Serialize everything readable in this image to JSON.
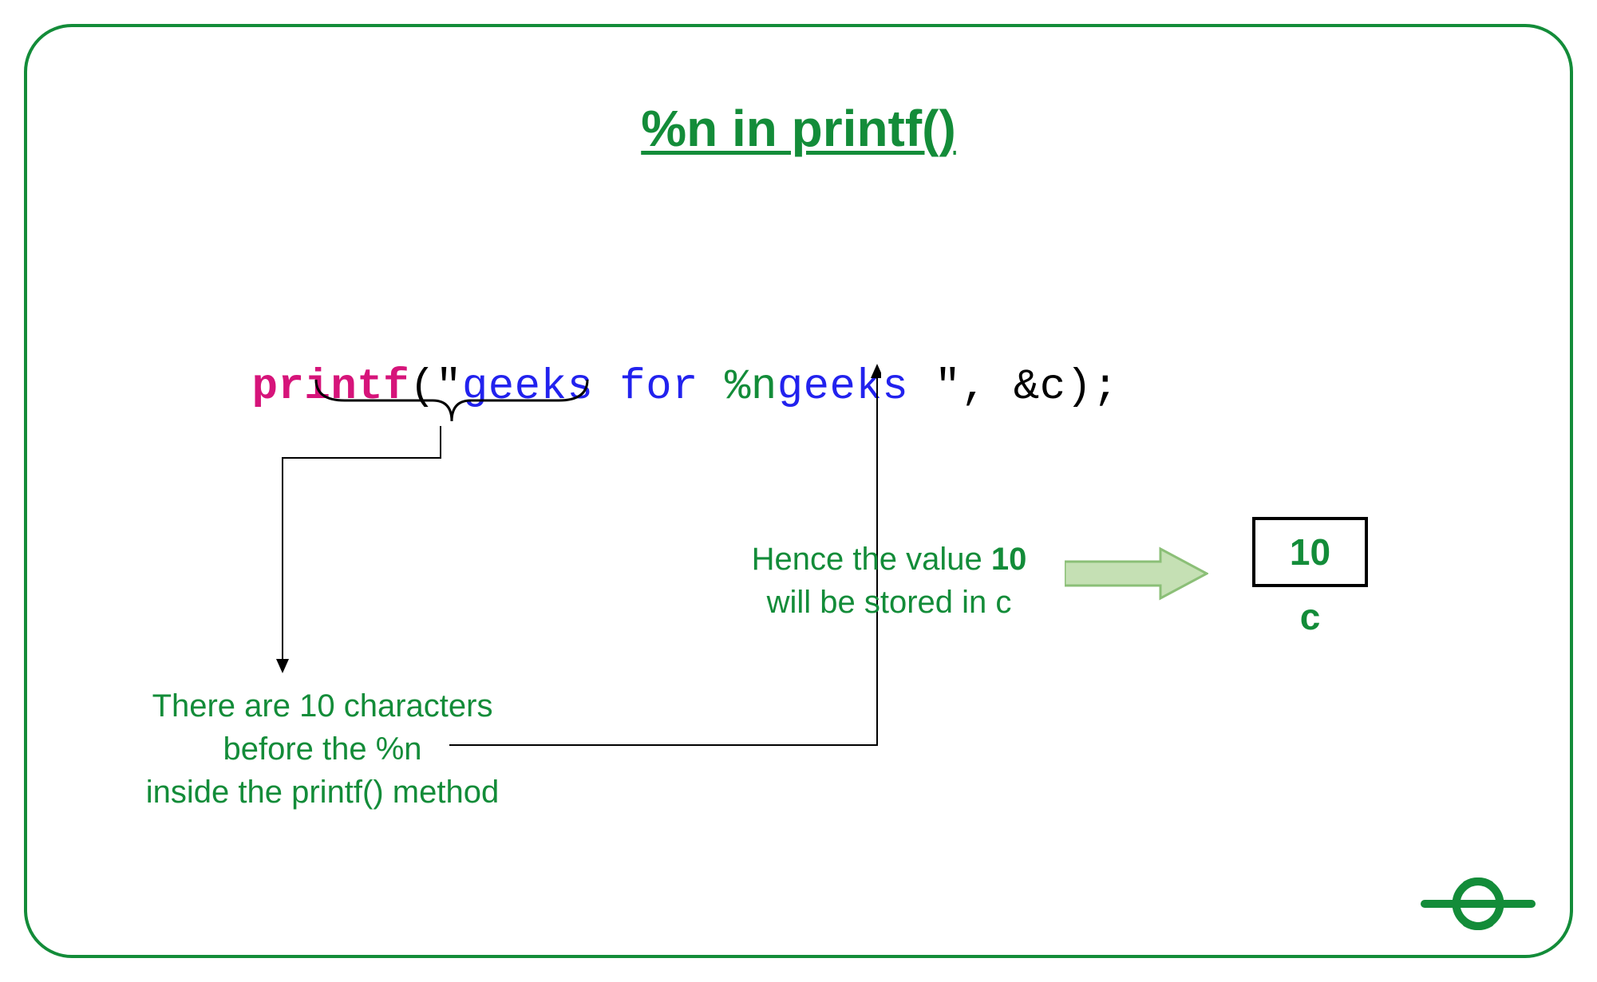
{
  "title": "%n in printf()",
  "code": {
    "printf": "printf",
    "open": "(",
    "q1": "\"",
    "part1": "geeks for ",
    "spec": "%n",
    "part2": "geeks ",
    "q2": "\"",
    "sep": ", &c);"
  },
  "explanations": {
    "left_line1": "There are 10 characters",
    "left_line2": "before the %n",
    "left_line3": "inside the printf() method",
    "right_line1_pre": "Hence the value ",
    "right_line1_strong": "10",
    "right_line2": "will be stored in c"
  },
  "box": {
    "value": "10",
    "var": "c"
  },
  "colors": {
    "brand": "#138c39",
    "arrow_fill": "#c5e0b4",
    "arrow_stroke": "#8bbf77"
  }
}
